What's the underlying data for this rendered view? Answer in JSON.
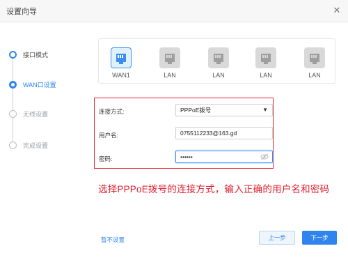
{
  "window": {
    "title": "设置向导",
    "close_icon": "close-icon"
  },
  "steps": [
    {
      "label": "接口模式",
      "state": "done"
    },
    {
      "label": "WAN口设置",
      "state": "active"
    },
    {
      "label": "无线设置",
      "state": "pending"
    },
    {
      "label": "完成设置",
      "state": "pending"
    }
  ],
  "ports": [
    {
      "label": "WAN1",
      "selected": true
    },
    {
      "label": "LAN",
      "selected": false
    },
    {
      "label": "LAN",
      "selected": false
    },
    {
      "label": "LAN",
      "selected": false
    },
    {
      "label": "LAN",
      "selected": false
    }
  ],
  "form": {
    "connection_label": "连接方式:",
    "connection_value": "PPPoE拨号",
    "username_label": "用户名:",
    "username_value": "0755112233@163.gd",
    "password_label": "密码:",
    "password_value": "••••••"
  },
  "caption": "选择PPPoE拨号的连接方式，输入正确的用户名和密码",
  "footer": {
    "skip_label": "暂不设置",
    "prev_label": "上一步",
    "next_label": "下一步"
  },
  "colors": {
    "accent": "#2f84ee",
    "highlight": "#e2202f"
  }
}
